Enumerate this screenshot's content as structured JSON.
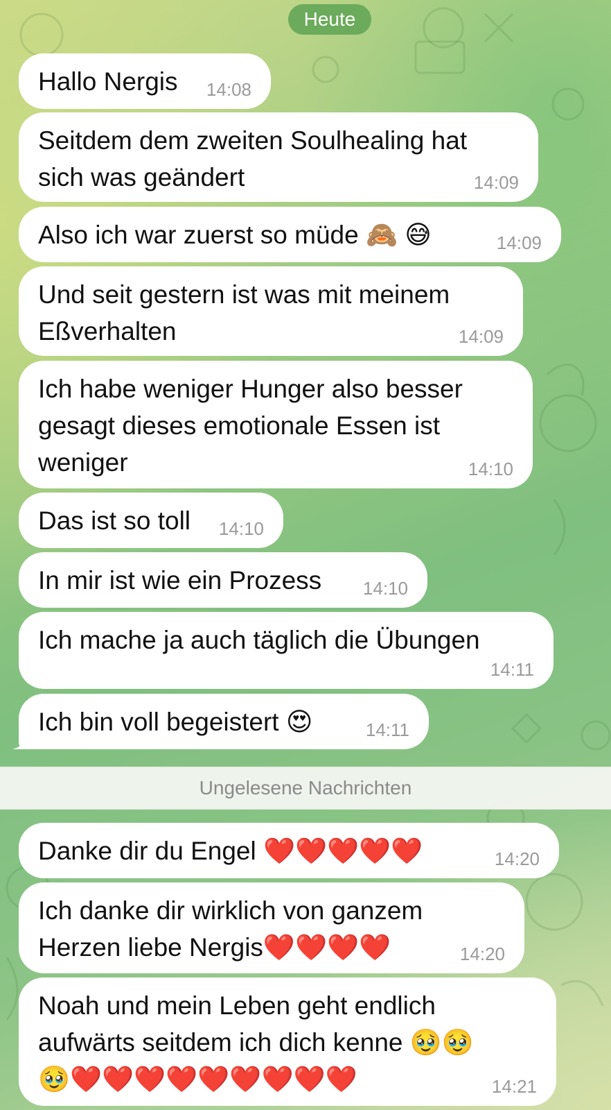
{
  "date_label": "Heute",
  "unread_label": "Ungelesene Nachrichten",
  "messages": [
    {
      "text": "Hallo Nergis",
      "time": "14:08"
    },
    {
      "text": "Seitdem dem zweiten Soulhealing hat\nsich was geändert",
      "time": "14:09"
    },
    {
      "text": "Also ich war zuerst so müde 🙈 😅",
      "time": "14:09"
    },
    {
      "text": "Und seit gestern ist was mit meinem\nEßverhalten",
      "time": "14:09"
    },
    {
      "text": "Ich habe weniger Hunger also besser\ngesagt dieses emotionale Essen ist\nweniger",
      "time": "14:10"
    },
    {
      "text": "Das ist so toll",
      "time": "14:10"
    },
    {
      "text": "In mir ist wie ein Prozess",
      "time": "14:10"
    },
    {
      "text": "Ich mache ja auch täglich die Übungen",
      "time": "14:11"
    },
    {
      "text": "Ich bin voll begeistert 😍",
      "time": "14:11"
    },
    {
      "text": "Danke dir du Engel ❤️❤️❤️❤️❤️",
      "time": "14:20"
    },
    {
      "text": "Ich danke dir wirklich von ganzem\nHerzen liebe Nergis❤️❤️❤️❤️",
      "time": "14:20"
    },
    {
      "text": "Noah und mein Leben geht endlich\naufwärts seitdem ich dich kenne 🥹🥹\n🥹❤️❤️❤️❤️❤️❤️❤️❤️❤️",
      "time": "14:21"
    }
  ]
}
